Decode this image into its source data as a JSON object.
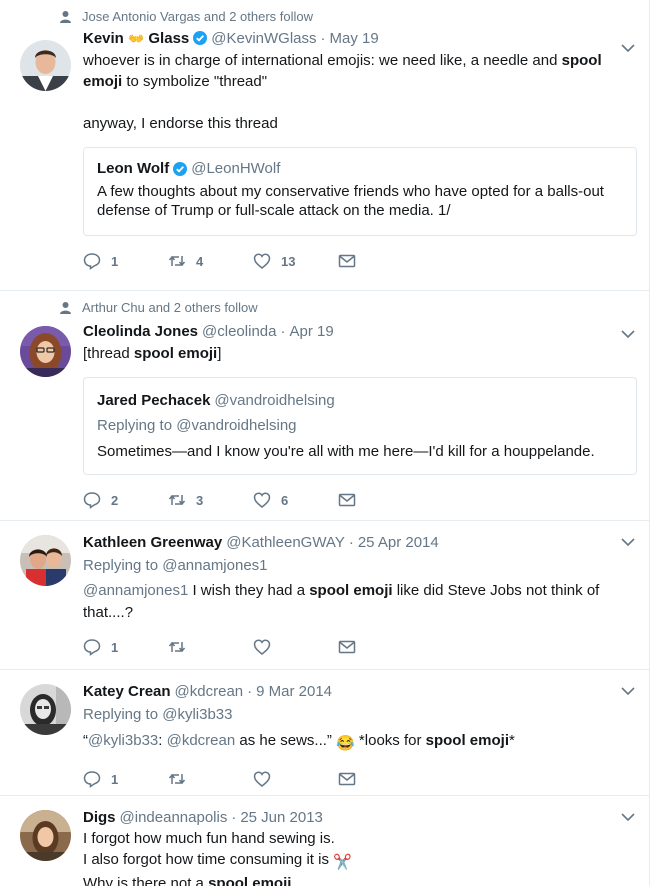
{
  "colors": {
    "accent": "#1da1f2",
    "secondary_text": "#657786",
    "border": "#e6ecf0"
  },
  "tweets": [
    {
      "social_context": "Jose Antonio Vargas and 2 others follow",
      "name_part1": "Kevin",
      "name_emoji": "👐",
      "name_part2": "Glass",
      "handle": "@KevinWGlass",
      "time": "May 19",
      "text_a": "whoever is in charge of international emojis: we need like, a needle and ",
      "text_bold": "spool emoji",
      "text_b": " to symbolize \"thread\"",
      "text_c": "anyway, I endorse this thread",
      "quote": {
        "name": "Leon Wolf",
        "handle": "@LeonHWolf",
        "text": "A few thoughts about my conservative friends who have opted for a balls-out defense of Trump or full-scale attack on the media. 1/"
      },
      "replies": "1",
      "retweets": "4",
      "likes": "13"
    },
    {
      "social_context": "Arthur Chu and 2 others follow",
      "name": "Cleolinda Jones",
      "handle": "@cleolinda",
      "time": "Apr 19",
      "text_a": "[thread ",
      "text_bold": "spool emoji",
      "text_b": "]",
      "quote": {
        "name": "Jared Pechacek",
        "handle": "@vandroidhelsing",
        "replying_prefix": "Replying to ",
        "replying_to": "@vandroidhelsing",
        "text": "Sometimes—and I know you're all with me here—I'd kill for a houppelande."
      },
      "replies": "2",
      "retweets": "3",
      "likes": "6"
    },
    {
      "name": "Kathleen Greenway",
      "handle": "@KathleenGWAY",
      "time": "25 Apr 2014",
      "replying_prefix": "Replying to ",
      "replying_to": "@annamjones1",
      "text_mention": "@annamjones1",
      "text_a": " I wish they had a ",
      "text_bold": "spool emoji",
      "text_b": " like did Steve Jobs not think of that....?",
      "replies": "1"
    },
    {
      "name": "Katey Crean",
      "handle": "@kdcrean",
      "time": "9 Mar 2014",
      "replying_prefix": "Replying to ",
      "replying_to": "@kyli3b33",
      "text_open": "“",
      "text_mention1": "@kyli3b33",
      "text_colon": ": ",
      "text_mention2": "@kdcrean",
      "text_a": " as he sews...” ",
      "text_emoji": "😂",
      "text_b": " *looks for ",
      "text_bold": "spool emoji",
      "text_c": "*",
      "replies": "1"
    },
    {
      "name": "Digs",
      "handle": "@indeannapolis",
      "time": "25 Jun 2013",
      "line1": "I forgot how much fun hand sewing is.",
      "line2": "I also forgot how time consuming it is ",
      "line2_emoji": "✂️",
      "line3_a": "Why is there not a ",
      "line3_bold": "spool emoji"
    }
  ]
}
